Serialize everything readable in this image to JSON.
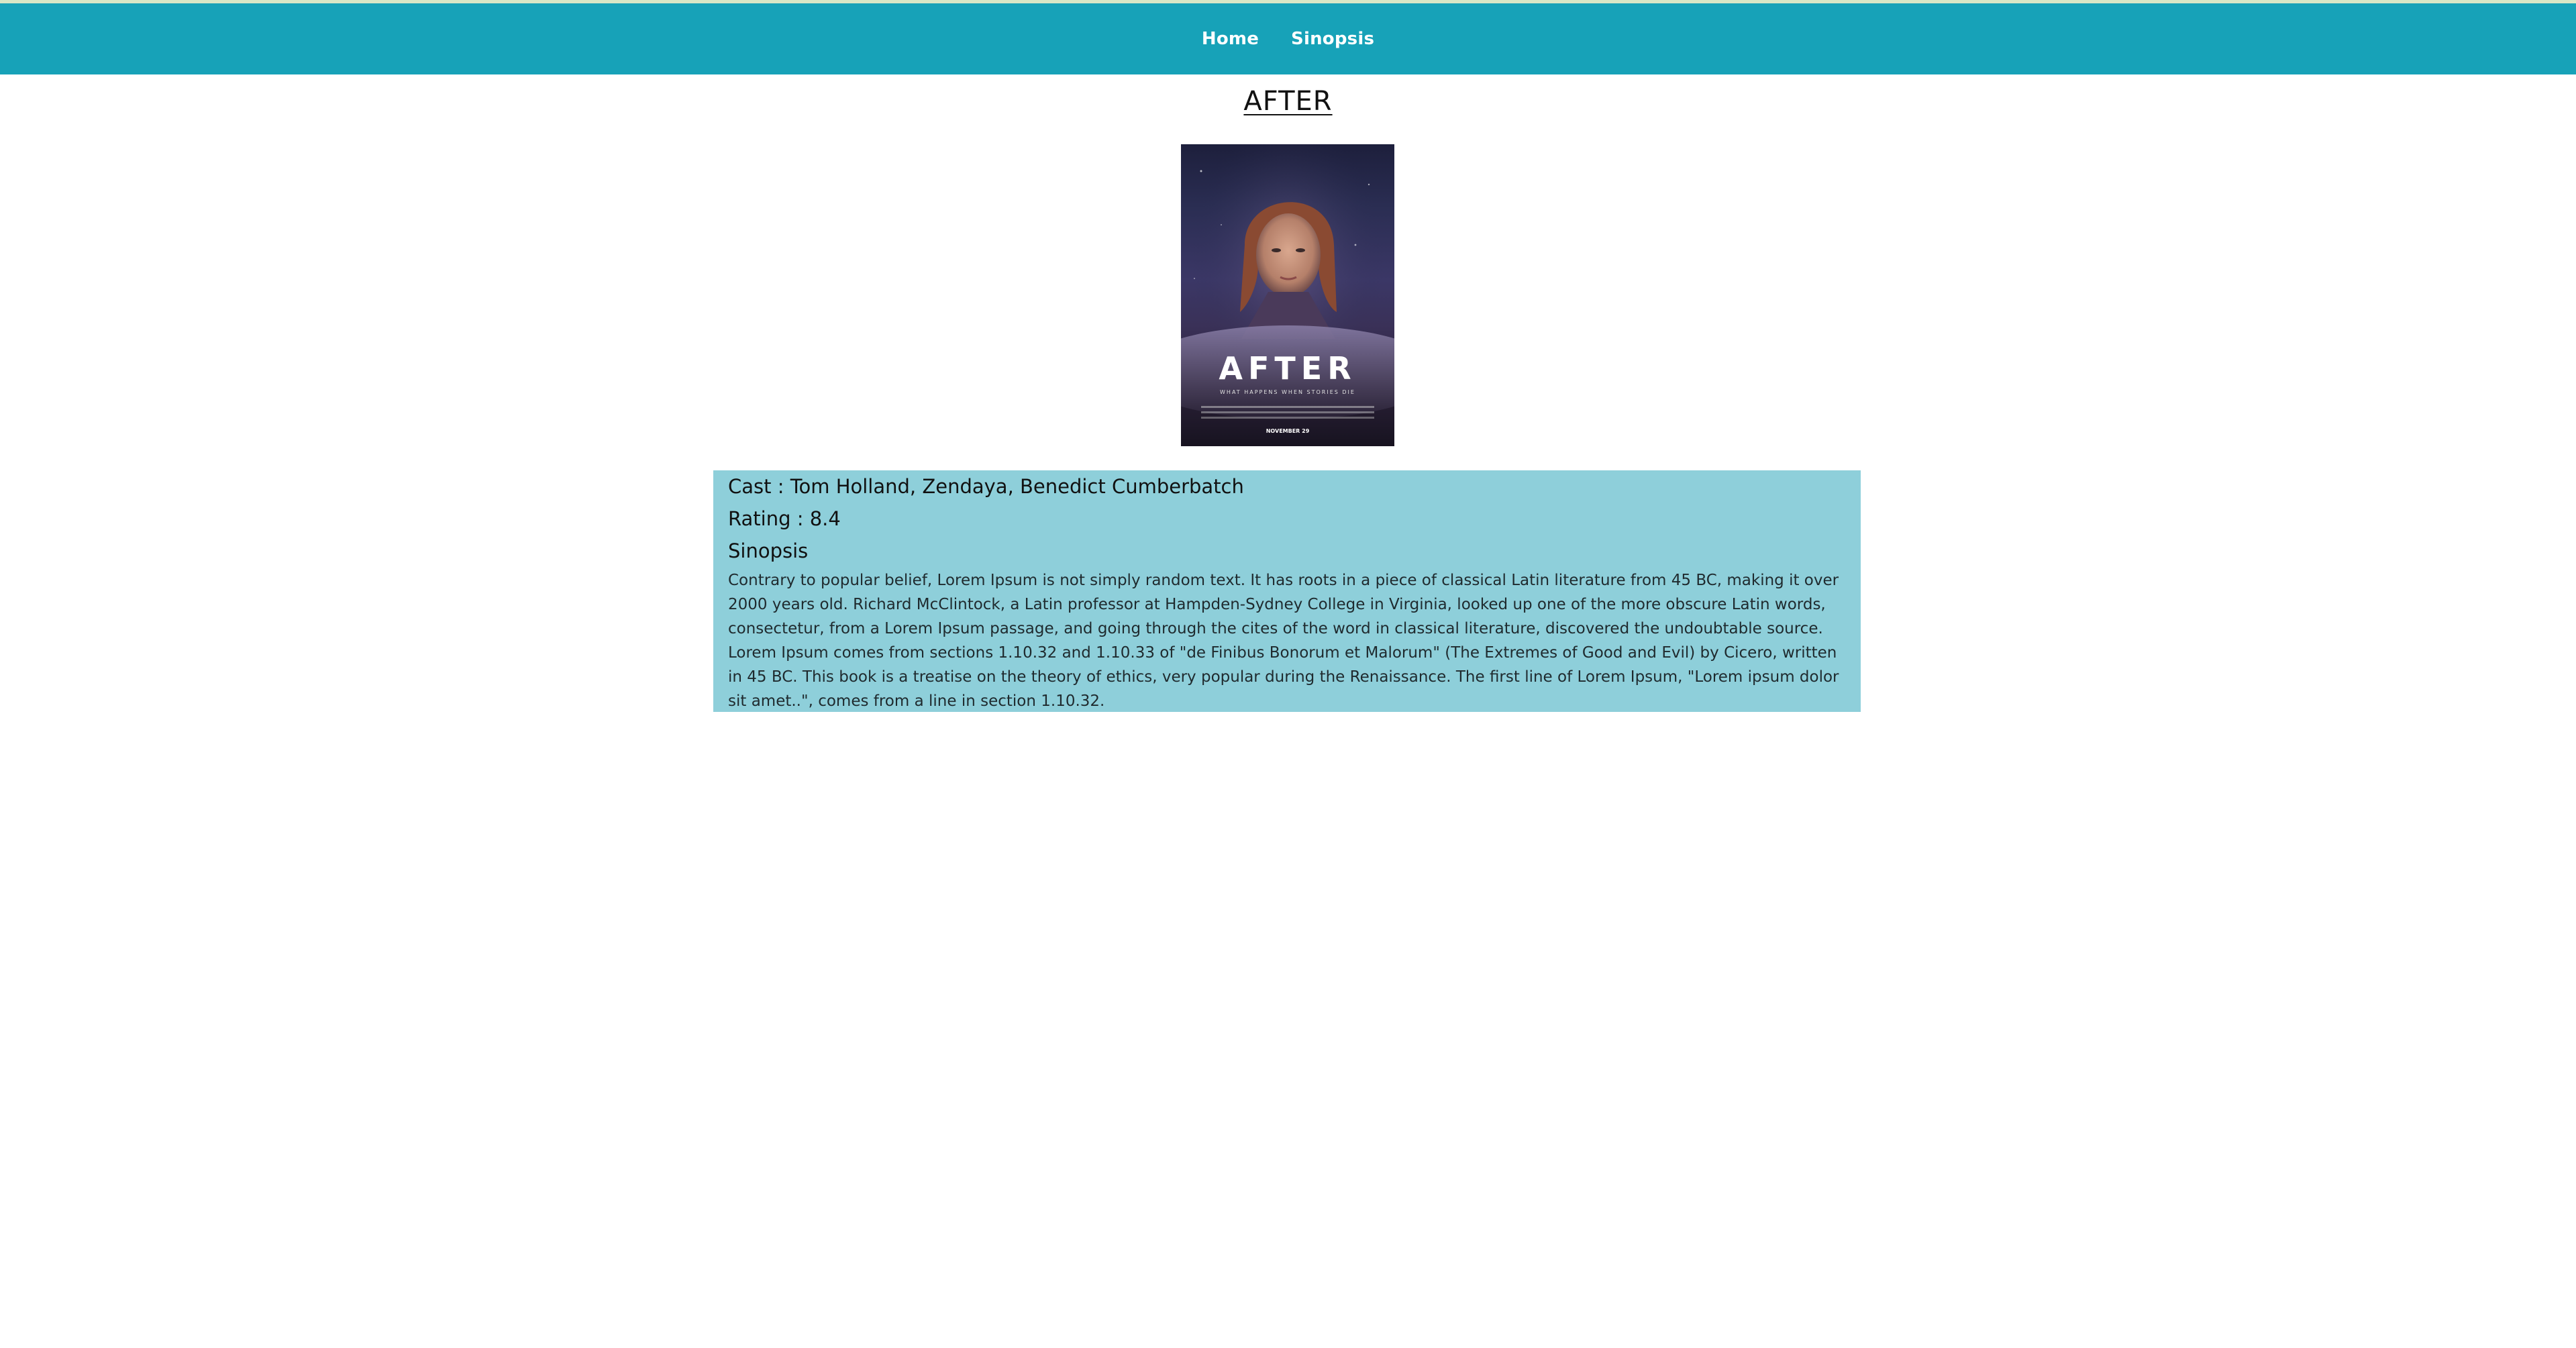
{
  "nav": {
    "links": [
      "Home",
      "Sinopsis"
    ]
  },
  "movie": {
    "title": "AFTER",
    "poster": {
      "title_text": "AFTER",
      "tagline": "WHAT HAPPENS WHEN STORIES DIE",
      "release": "NOVEMBER 29"
    },
    "cast_line": "Cast : Tom Holland, Zendaya, Benedict Cumberbatch",
    "rating_line": "Rating : 8.4",
    "sinopsis_heading": "Sinopsis",
    "sinopsis_text": "Contrary to popular belief, Lorem Ipsum is not simply random text. It has roots in a piece of classical Latin literature from 45 BC, making it over 2000 years old. Richard McClintock, a Latin professor at Hampden-Sydney College in Virginia, looked up one of the more obscure Latin words, consectetur, from a Lorem Ipsum passage, and going through the cites of the word in classical literature, discovered the undoubtable source. Lorem Ipsum comes from sections 1.10.32 and 1.10.33 of \"de Finibus Bonorum et Malorum\" (The Extremes of Good and Evil) by Cicero, written in 45 BC. This book is a treatise on the theory of ethics, very popular during the Renaissance. The first line of Lorem Ipsum, \"Lorem ipsum dolor sit amet..\", comes from a line in section 1.10.32."
  },
  "colors": {
    "navbar": "#17a2b8",
    "info_box": "#8ecfda",
    "nav_text": "#ffffff"
  }
}
